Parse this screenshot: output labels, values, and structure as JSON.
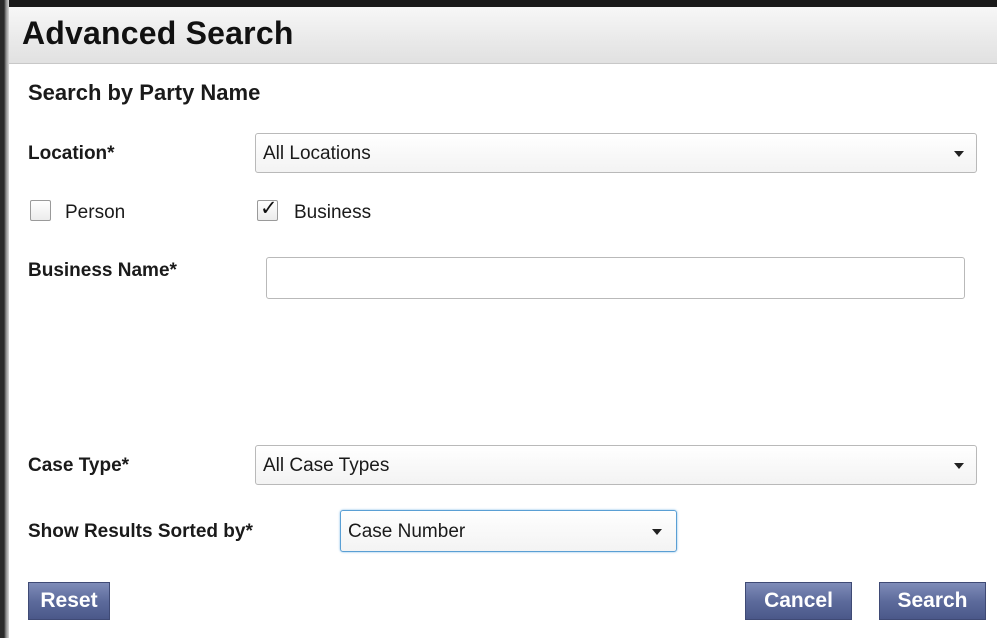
{
  "dialog": {
    "title": "Advanced Search",
    "section_heading": "Search by Party Name"
  },
  "location": {
    "label": "Location*",
    "selected": "All Locations"
  },
  "party_type": {
    "person_label": "Person",
    "person_checked": false,
    "business_label": "Business",
    "business_checked": true,
    "check_glyph": "✓"
  },
  "business_name": {
    "label": "Business Name*",
    "value": ""
  },
  "case_type": {
    "label": "Case Type*",
    "selected": "All Case Types"
  },
  "sort": {
    "label": "Show Results Sorted by*",
    "selected": "Case Number"
  },
  "buttons": {
    "reset": "Reset",
    "cancel": "Cancel",
    "search": "Search"
  },
  "colors": {
    "button_primary": "#5d6b9c",
    "focus_border": "#5a9fd4"
  }
}
